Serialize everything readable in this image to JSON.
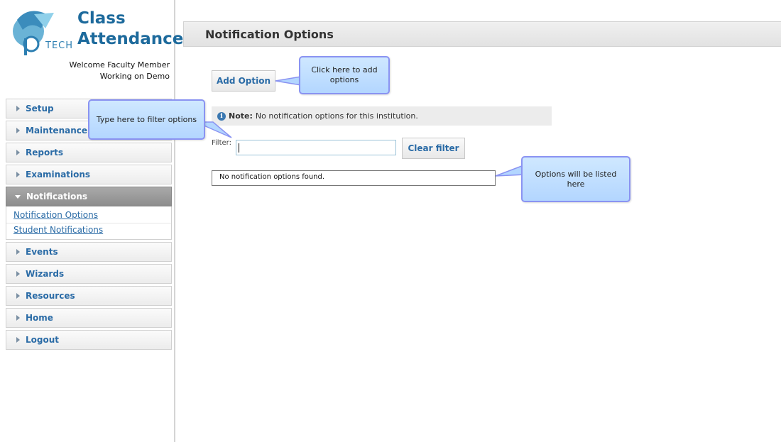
{
  "app": {
    "logo_text": "TECH",
    "title_line1": "Class",
    "title_line2": "Attendance",
    "welcome": "Welcome Faculty Member",
    "working_on": "Working on Demo"
  },
  "sidebar": {
    "items_top": [
      {
        "label": "Setup"
      },
      {
        "label": "Maintenance"
      },
      {
        "label": "Reports"
      },
      {
        "label": "Examinations"
      }
    ],
    "active": {
      "label": "Notifications"
    },
    "submenu": [
      {
        "label": "Notification Options"
      },
      {
        "label": "Student Notifications"
      }
    ],
    "items_bottom": [
      {
        "label": "Events"
      },
      {
        "label": "Wizards"
      },
      {
        "label": "Resources"
      },
      {
        "label": "Home"
      },
      {
        "label": "Logout"
      }
    ]
  },
  "main": {
    "title": "Notification Options",
    "add_button": "Add Option",
    "note_label": "Note:",
    "note_text": "No notification options for this institution.",
    "filter_label": "Filter:",
    "filter_value": "",
    "clear_button": "Clear filter",
    "results_empty": "No notification options found."
  },
  "callouts": {
    "add": "Click here to add options",
    "filter": "Type here to filter options",
    "list": "Options will be listed here"
  },
  "colors": {
    "accent": "#2a6ba6",
    "title_blue": "#1d6a9c",
    "callout_fill": "#b3d6ff",
    "callout_border": "#8a93f2"
  }
}
